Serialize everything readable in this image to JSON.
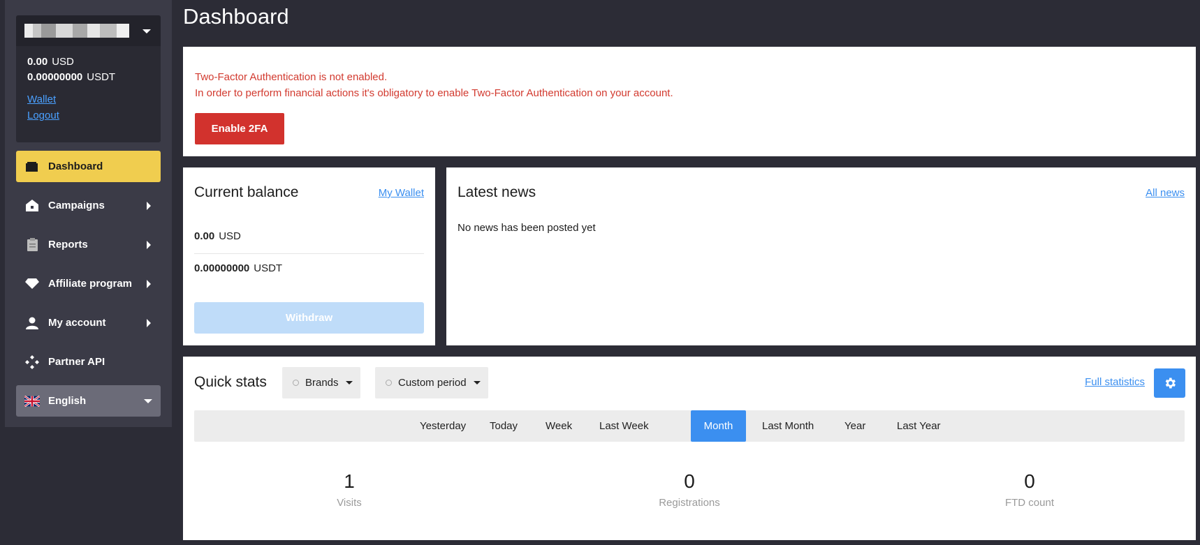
{
  "account": {
    "balances": [
      {
        "amount": "0.00",
        "currency": "USD"
      },
      {
        "amount": "0.00000000",
        "currency": "USDT"
      }
    ],
    "wallet_link": "Wallet",
    "logout_link": "Logout"
  },
  "sidebar": {
    "items": [
      {
        "label": "Dashboard",
        "icon": "wallet-icon"
      },
      {
        "label": "Campaigns",
        "icon": "home-icon"
      },
      {
        "label": "Reports",
        "icon": "clipboard-icon"
      },
      {
        "label": "Affiliate program",
        "icon": "diamond-icon"
      },
      {
        "label": "My account",
        "icon": "user-icon"
      },
      {
        "label": "Partner API",
        "icon": "api-icon"
      }
    ],
    "language": "English"
  },
  "page": {
    "title": "Dashboard"
  },
  "alert": {
    "line1": "Two-Factor Authentication is not enabled.",
    "line2": "In order to perform financial actions it's obligatory to enable Two-Factor Authentication on your account.",
    "button": "Enable 2FA"
  },
  "balance_card": {
    "title": "Current balance",
    "link": "My Wallet",
    "rows": [
      {
        "amount": "0.00",
        "currency": "USD"
      },
      {
        "amount": "0.00000000",
        "currency": "USDT"
      }
    ],
    "withdraw": "Withdraw"
  },
  "news": {
    "title": "Latest news",
    "link": "All news",
    "empty": "No news has been posted yet"
  },
  "quick_stats": {
    "title": "Quick stats",
    "brands_dropdown": "Brands",
    "period_dropdown": "Custom period",
    "full_link": "Full statistics",
    "periods": [
      "Yesterday",
      "Today",
      "Week",
      "Last Week",
      "Month",
      "Last Month",
      "Year",
      "Last Year"
    ],
    "active_period": "Month",
    "stats": [
      {
        "value": "1",
        "label": "Visits"
      },
      {
        "value": "0",
        "label": "Registrations"
      },
      {
        "value": "0",
        "label": "FTD count"
      }
    ]
  },
  "colors": {
    "accent": "#3b8ff0",
    "active_nav": "#f0cd4f",
    "danger": "#d2322d"
  }
}
